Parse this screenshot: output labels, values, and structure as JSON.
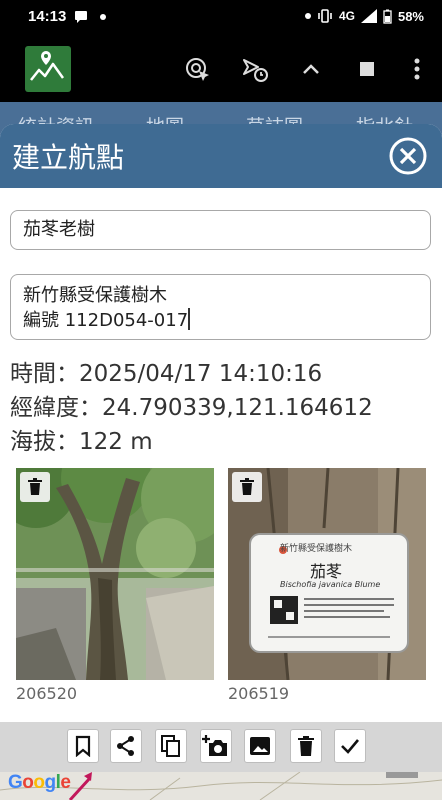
{
  "status_bar": {
    "time": "14:13",
    "network": "4G",
    "battery": "58%"
  },
  "background_tabs": [
    "統計資訊",
    "地圖",
    "草誌圖",
    "指北針"
  ],
  "dialog": {
    "title": "建立航點",
    "name_value": "茄苳老樹",
    "description_line1": "新竹縣受保護樹木",
    "description_line2": "編號 112D054-017",
    "time_text": "時間：2025/04/17 14:10:16",
    "coord_text": "經緯度：24.790339,121.164612",
    "altitude_text": "海拔：122 m",
    "photos": [
      {
        "caption": "206520"
      },
      {
        "caption": "206519"
      }
    ],
    "sign": {
      "org": "新竹縣受保護樹木",
      "species": "茄苳",
      "latin": "Bischofia javanica Blume"
    }
  },
  "actions": [
    "bookmark-icon",
    "share-icon",
    "copy-icon",
    "add-photo-icon",
    "image-icon",
    "delete-icon",
    "check-icon"
  ],
  "map": {
    "logo": "Google"
  },
  "colors": {
    "header": "#3f6b93",
    "tabs": "#4a6f96",
    "logo_bg": "#2f7b3a"
  }
}
